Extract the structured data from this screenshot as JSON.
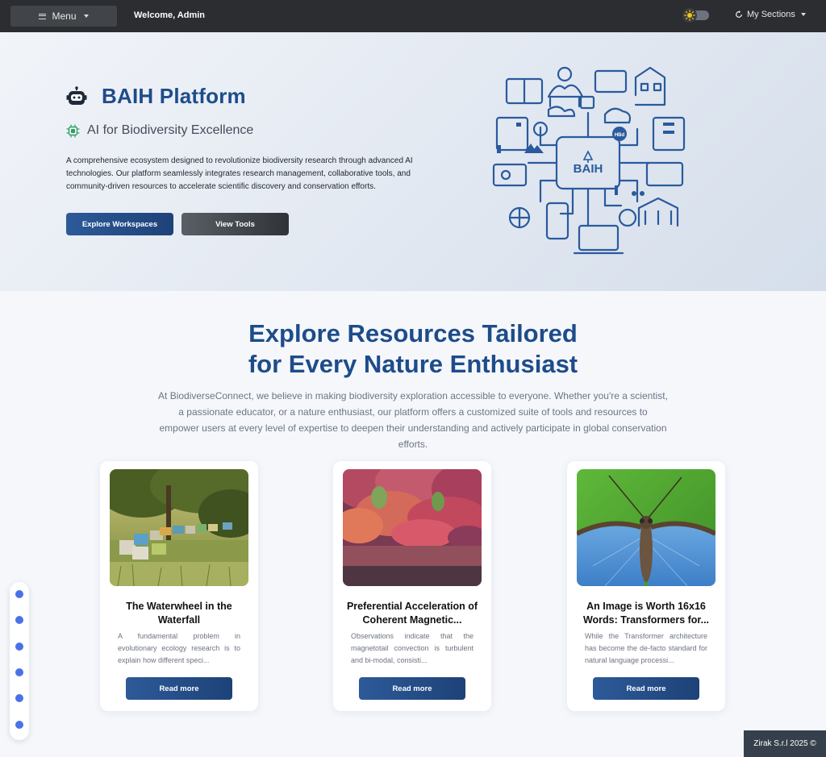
{
  "topbar": {
    "menu_label": "Menu",
    "welcome": "Welcome, Admin",
    "my_sections": "My Sections"
  },
  "hero": {
    "title": "BAIH Platform",
    "subtitle": "AI for Biodiversity Excellence",
    "description": "A comprehensive ecosystem designed to revolutionize biodiversity research through advanced AI technologies. Our platform seamlessly integrates research management, collaborative tools, and community-driven resources to accelerate scientific discovery and conservation efforts.",
    "primary_button": "Explore Workspaces",
    "secondary_button": "View Tools",
    "illustration_label": "BAIH",
    "illustration_small_label": "HBd"
  },
  "explore": {
    "title_line1": "Explore Resources Tailored",
    "title_line2": "for Every Nature Enthusiast",
    "description": "At BiodiverseConnect, we believe in making biodiversity exploration accessible to everyone. Whether you're a scientist, a passionate educator, or a nature enthusiast, our platform offers a customized suite of tools and resources to empower users at every level of expertise to deepen their understanding and actively participate in global conservation efforts."
  },
  "cards": [
    {
      "title": "The Waterwheel in the Waterfall",
      "description": "A fundamental problem in evolutionary ecology research is to explain how different speci...",
      "button": "Read more"
    },
    {
      "title": "Preferential Acceleration of Coherent Magnetic...",
      "description": "Observations indicate that the magnetotail convection is turbulent and bi-modal, consisti...",
      "button": "Read more"
    },
    {
      "title": "An Image is Worth 16x16 Words: Transformers for...",
      "description": "While the Transformer architecture has become the de-facto standard for natural language processi...",
      "button": "Read more"
    }
  ],
  "footer": {
    "copyright": "Zirak S.r.l 2025 ©"
  },
  "colors": {
    "brand_blue": "#1e4c8a",
    "topbar": "#2b2d30",
    "dot_blue": "#4a72e8"
  }
}
